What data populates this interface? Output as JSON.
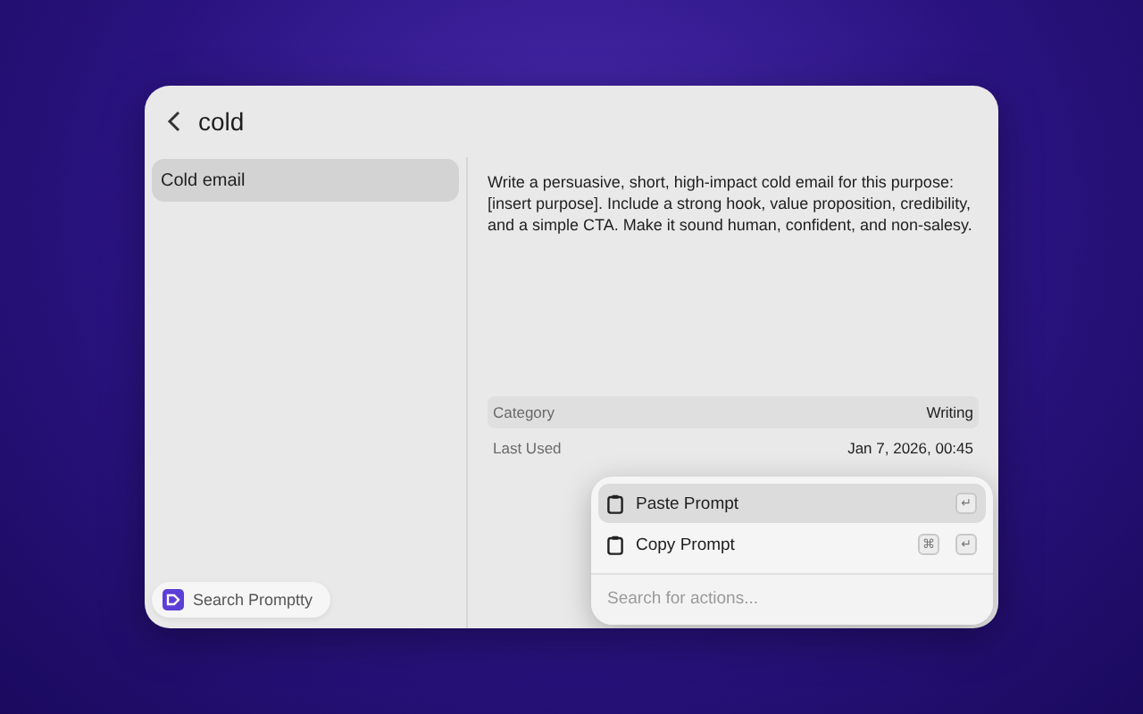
{
  "search": {
    "query": "cold"
  },
  "results": [
    {
      "label": "Cold email",
      "selected": true
    }
  ],
  "prompt": {
    "text": "Write a persuasive, short, high-impact cold email for this purpose: [insert purpose]. Include a strong hook, value proposition, credibility, and a simple CTA. Make it sound human, confident, and non-salesy."
  },
  "metadata": [
    {
      "label": "Category",
      "value": "Writing"
    },
    {
      "label": "Last Used",
      "value": "Jan 7, 2026, 00:45"
    }
  ],
  "actions": {
    "items": [
      {
        "label": "Paste Prompt",
        "keys": [
          "↵"
        ],
        "selected": true
      },
      {
        "label": "Copy Prompt",
        "keys": [
          "⌘",
          "↵"
        ],
        "selected": false
      }
    ],
    "placeholder": "Search for actions..."
  },
  "footer": {
    "label": "Search Promptty"
  }
}
